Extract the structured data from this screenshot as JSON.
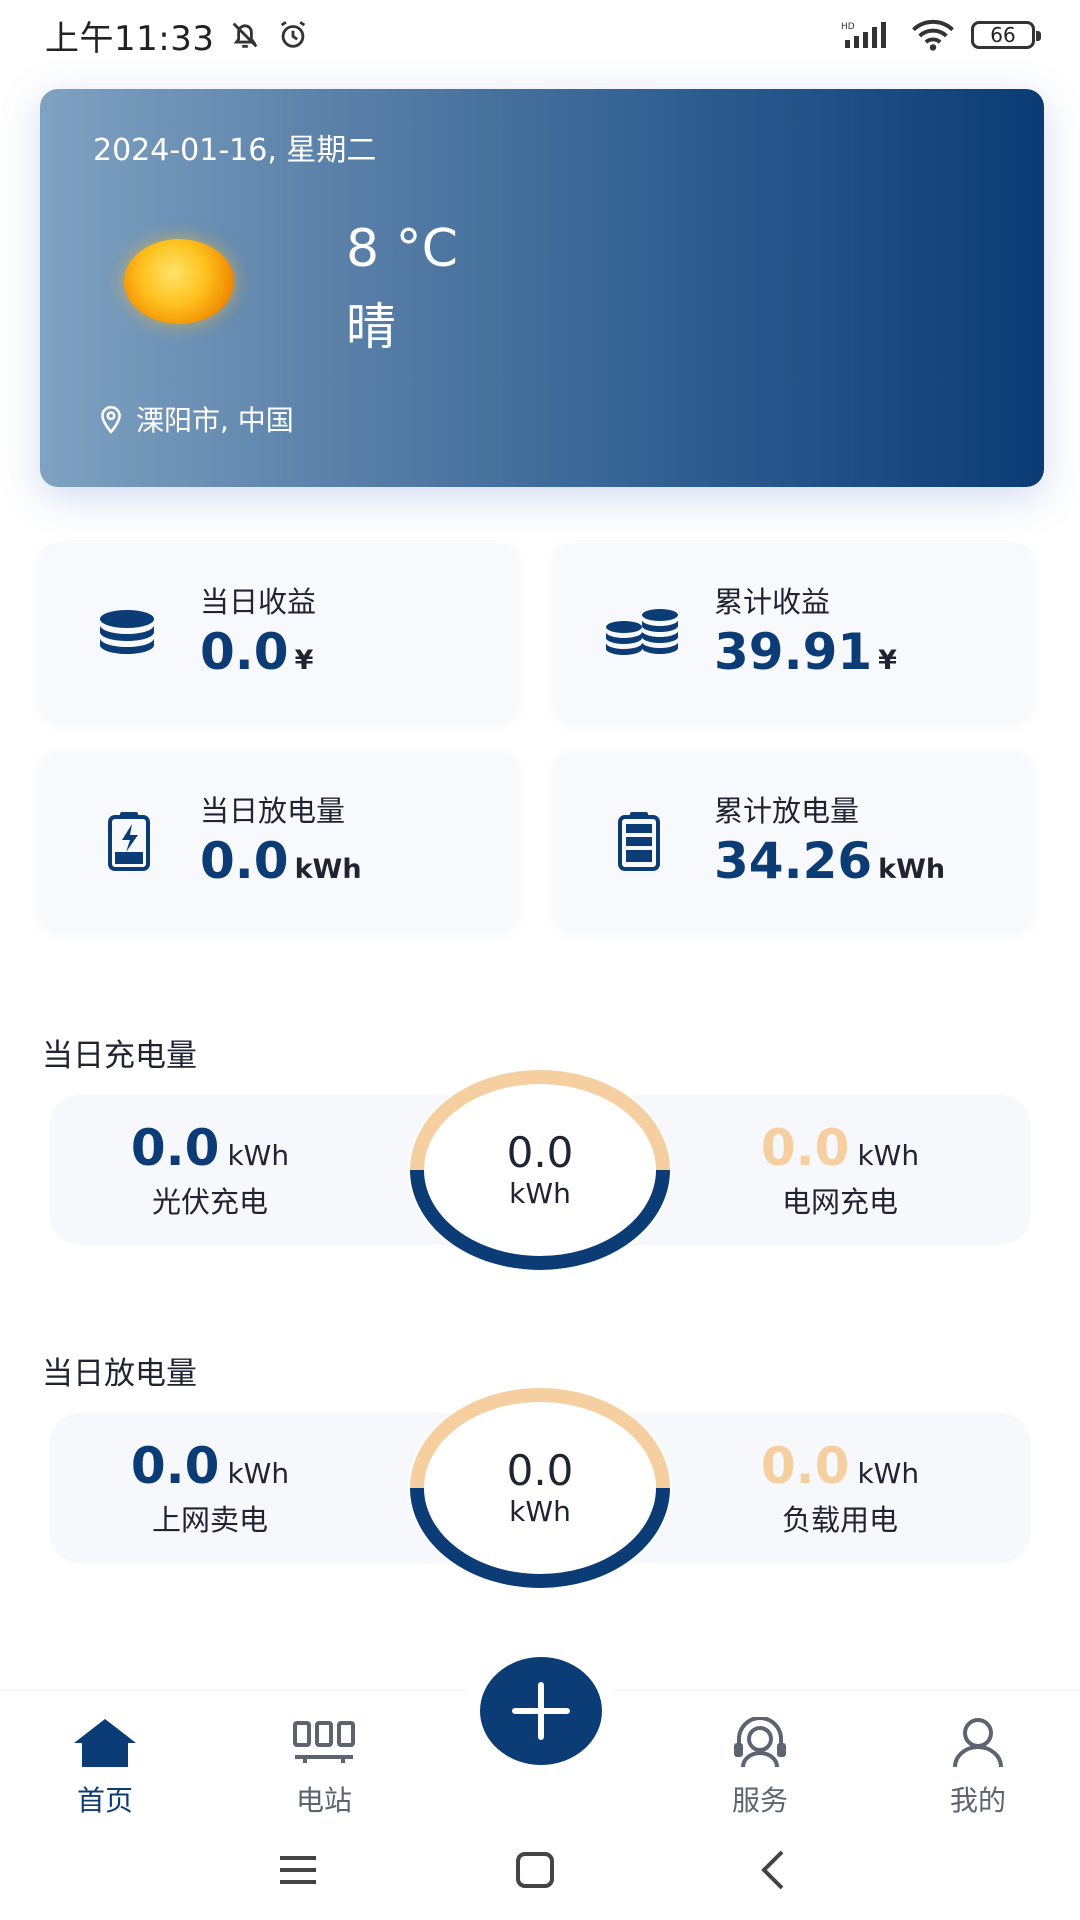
{
  "status_bar": {
    "time": "上午11:33",
    "battery": "66",
    "icons": [
      "mute-bell-icon",
      "alarm-icon",
      "hd-signal-icon",
      "wifi-icon",
      "battery-icon"
    ]
  },
  "weather": {
    "date": "2024-01-16, 星期二",
    "temperature": "8 °C",
    "condition": "晴",
    "location": "溧阳市, 中国",
    "icon": "sun-icon"
  },
  "stats": [
    {
      "label": "当日收益",
      "value": "0.0",
      "unit": "¥",
      "icon": "coins-stack-icon"
    },
    {
      "label": "累计收益",
      "value": "39.91",
      "unit": "¥",
      "icon": "coins-double-stack-icon"
    },
    {
      "label": "当日放电量",
      "value": "0.0",
      "unit": "kWh",
      "icon": "battery-charging-icon"
    },
    {
      "label": "累计放电量",
      "value": "34.26",
      "unit": "kWh",
      "icon": "battery-full-icon"
    }
  ],
  "charge_section": {
    "title": "当日充电量",
    "left": {
      "value": "0.0",
      "unit": "kWh",
      "label": "光伏充电"
    },
    "center": {
      "value": "0.0",
      "unit": "kWh"
    },
    "right": {
      "value": "0.0",
      "unit": "kWh",
      "label": "电网充电"
    }
  },
  "discharge_section": {
    "title": "当日放电量",
    "left": {
      "value": "0.0",
      "unit": "kWh",
      "label": "上网卖电"
    },
    "center": {
      "value": "0.0",
      "unit": "kWh"
    },
    "right": {
      "value": "0.0",
      "unit": "kWh",
      "label": "负载用电"
    }
  },
  "bottom_nav": {
    "items": [
      {
        "label": "首页",
        "icon": "home-icon",
        "active": true
      },
      {
        "label": "电站",
        "icon": "station-icon",
        "active": false
      },
      {
        "label": "服务",
        "icon": "service-headset-icon",
        "active": false
      },
      {
        "label": "我的",
        "icon": "user-icon",
        "active": false
      }
    ],
    "fab_icon": "plus-icon"
  },
  "colors": {
    "primary": "#0c3c75",
    "accent_light": "#f5cfa0",
    "card_bg": "#f8f9fc"
  }
}
